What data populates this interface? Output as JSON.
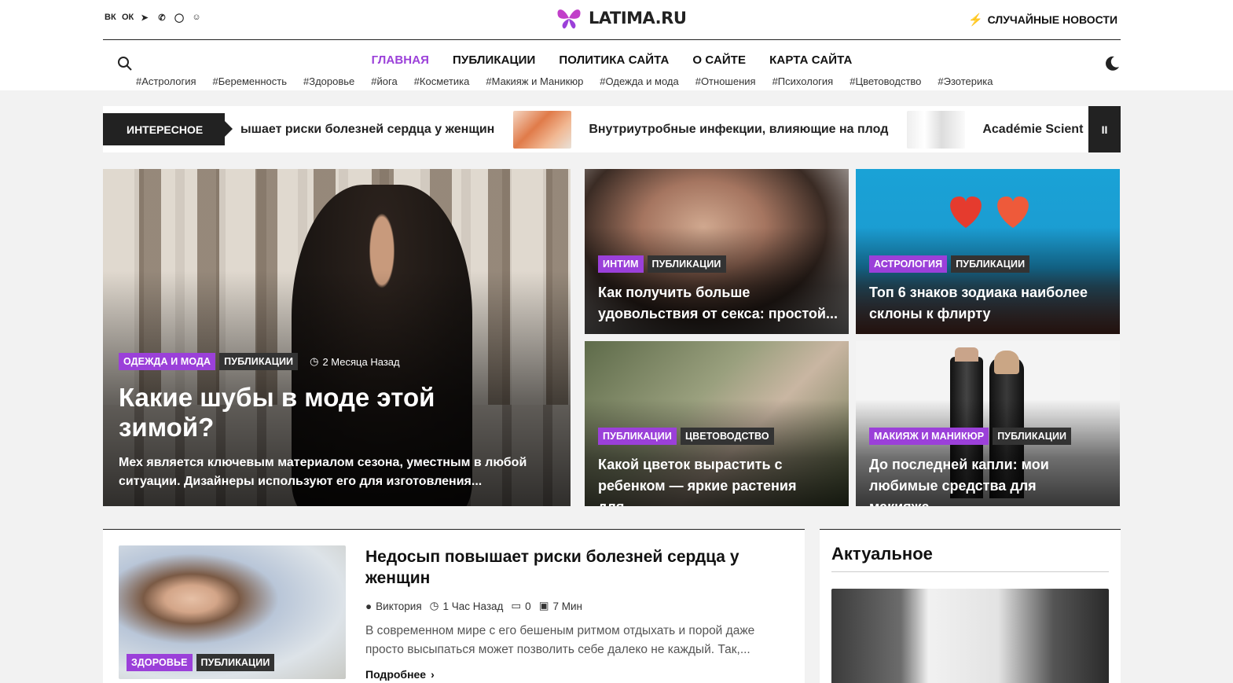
{
  "header": {
    "socials": [
      {
        "icon": "vk-icon",
        "glyph": "ВК"
      },
      {
        "icon": "odnoklassniki-icon",
        "glyph": "ОК"
      },
      {
        "icon": "telegram-icon",
        "glyph": "➤"
      },
      {
        "icon": "viber-icon",
        "glyph": "✆"
      },
      {
        "icon": "whatsapp-icon",
        "glyph": "◯"
      },
      {
        "icon": "smile-icon",
        "glyph": "☺"
      }
    ],
    "logo_text": "LATIMA.RU",
    "random_news": "СЛУЧАЙНЫЕ НОВОСТИ",
    "brand_color": "#9b40d9"
  },
  "menu": [
    "ГЛАВНАЯ",
    "ПУБЛИКАЦИИ",
    "ПОЛИТИКА САЙТА",
    "О САЙТЕ",
    "КАРТА САЙТА"
  ],
  "tags": [
    "#Астрология",
    "#Беременность",
    "#Здоровье",
    "#йога",
    "#Косметика",
    "#Макияж и Маникюр",
    "#Одежда и мода",
    "#Отношения",
    "#Психология",
    "#Цветоводство",
    "#Эзотерика"
  ],
  "ticker": {
    "label": "ИНТЕРЕСНОЕ",
    "items": [
      "ышает риски болезней сердца у женщин",
      "Внутриутробные инфекции, влияющие на плод",
      "Académie Scient"
    ],
    "pause": "II"
  },
  "hero": {
    "main": {
      "badges": [
        "ОДЕЖДА И МОДА",
        "ПУБЛИКАЦИИ"
      ],
      "time": "2 Месяца Назад",
      "title": "Какие шубы в моде этой зимой?",
      "excerpt": " Мех является ключевым материалом сезона, уместным в любой ситуации. Дизайнеры используют его для изготовления..."
    },
    "cards": [
      {
        "badges": [
          "ИНТИМ",
          "ПУБЛИКАЦИИ"
        ],
        "title": "Как получить больше удовольствия от секса: простой..."
      },
      {
        "badges": [
          "АСТРОЛОГИЯ",
          "ПУБЛИКАЦИИ"
        ],
        "title": "Топ 6 знаков зодиака наиболее склоны к флирту"
      },
      {
        "badges": [
          "ПУБЛИКАЦИИ",
          "ЦВЕТОВОДСТВО"
        ],
        "title": "Какой цветок вырастить с ребенком — яркие растения для..."
      },
      {
        "badges": [
          "МАКИЯЖ И МАНИКЮР",
          "ПУБЛИКАЦИИ"
        ],
        "title": "До последней капли: мои любимые средства для макияжа..."
      }
    ]
  },
  "post": {
    "badges": [
      "ЗДОРОВЬЕ",
      "ПУБЛИКАЦИИ"
    ],
    "title": "Недосып повышает риски болезней сердца у женщин",
    "author": "Виктория",
    "time": "1 Час Назад",
    "comments": "0",
    "read": "7 Мин",
    "excerpt": "В современном мире с его бешеным ритмом отдыхать и порой даже просто высыпаться может позволить себе далеко не каждый. Так,...",
    "more": "Подробнее"
  },
  "sidebar": {
    "title": "Актуальное"
  }
}
